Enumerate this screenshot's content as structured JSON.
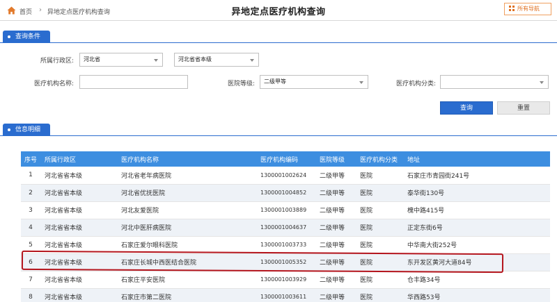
{
  "header": {
    "breadcrumb_home": "首页",
    "breadcrumb_sep": "›",
    "breadcrumb_current": "异地定点医疗机构查询",
    "title": "异地定点医疗机构查询",
    "nav_button": "所有导航"
  },
  "query_section": {
    "title": "查询条件",
    "region_label": "所属行政区:",
    "province_value": "河北省",
    "city_value": "河北省省本级",
    "org_name_label": "医疗机构名称:",
    "org_name_value": "",
    "level_label": "医院等级:",
    "level_value": "二级甲等",
    "category_label": "医疗机构分类:",
    "category_value": "",
    "query_button": "查询",
    "reset_button": "重置"
  },
  "detail_section": {
    "title": "信息明细",
    "columns": [
      "序号",
      "所属行政区",
      "医疗机构名称",
      "医疗机构编码",
      "医院等级",
      "医疗机构分类",
      "地址"
    ],
    "rows": [
      {
        "no": "1",
        "region": "河北省省本级",
        "name": "河北省老年病医院",
        "code": "1300001002624",
        "level": "二级甲等",
        "category": "医院",
        "address": "石家庄市青园街241号"
      },
      {
        "no": "2",
        "region": "河北省省本级",
        "name": "河北省优抚医院",
        "code": "1300001004852",
        "level": "二级甲等",
        "category": "医院",
        "address": "泰华街130号"
      },
      {
        "no": "3",
        "region": "河北省省本级",
        "name": "河北友爱医院",
        "code": "1300001003889",
        "level": "二级甲等",
        "category": "医院",
        "address": "槐中路415号"
      },
      {
        "no": "4",
        "region": "河北省省本级",
        "name": "河北中医肝病医院",
        "code": "1300001004637",
        "level": "二级甲等",
        "category": "医院",
        "address": "正定东街6号"
      },
      {
        "no": "5",
        "region": "河北省省本级",
        "name": "石家庄爱尔眼科医院",
        "code": "1300001003733",
        "level": "二级甲等",
        "category": "医院",
        "address": "中华南大街252号"
      },
      {
        "no": "6",
        "region": "河北省省本级",
        "name": "石家庄长城中西医结合医院",
        "code": "1300001005352",
        "level": "二级甲等",
        "category": "医院",
        "address": "东开发区黄河大道84号"
      },
      {
        "no": "7",
        "region": "河北省省本级",
        "name": "石家庄平安医院",
        "code": "1300001003929",
        "level": "二级甲等",
        "category": "医院",
        "address": "仓丰路34号"
      },
      {
        "no": "8",
        "region": "河北省省本级",
        "name": "石家庄市第二医院",
        "code": "1300001003611",
        "level": "二级甲等",
        "category": "医院",
        "address": "华西路53号"
      }
    ]
  },
  "colors": {
    "accent": "#2a6ccf",
    "table_header": "#3d8ee0",
    "nav_button": "#e07020",
    "highlight": "#b4141c"
  }
}
